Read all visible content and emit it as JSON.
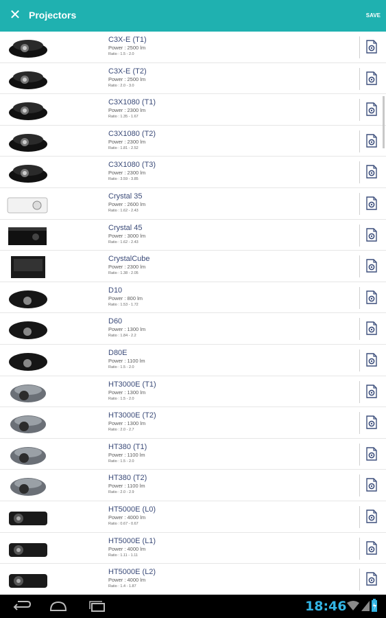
{
  "app": {
    "title": "Projectors",
    "save_label": "SAVE",
    "close_icon": "close-icon"
  },
  "projectors": [
    {
      "name": "C3X-E (T1)",
      "power": "Power : 2500 lm",
      "ratio": "Ratio : 1.5 - 2.0",
      "style": "dark"
    },
    {
      "name": "C3X-E (T2)",
      "power": "Power : 2500 lm",
      "ratio": "Ratio : 2.0 - 3.0",
      "style": "dark"
    },
    {
      "name": "C3X1080 (T1)",
      "power": "Power : 2300 lm",
      "ratio": "Ratio : 1.35 - 1.67",
      "style": "dark"
    },
    {
      "name": "C3X1080 (T2)",
      "power": "Power : 2300 lm",
      "ratio": "Ratio : 1.81 - 2.52",
      "style": "dark"
    },
    {
      "name": "C3X1080 (T3)",
      "power": "Power : 2300 lm",
      "ratio": "Ratio : 3.59 - 3.85",
      "style": "dark"
    },
    {
      "name": "Crystal 35",
      "power": "Power : 2600 lm",
      "ratio": "Ratio : 1.62 - 2.43",
      "style": "white"
    },
    {
      "name": "Crystal 45",
      "power": "Power : 3000 lm",
      "ratio": "Ratio : 1.62 - 2.43",
      "style": "box"
    },
    {
      "name": "CrystalCube",
      "power": "Power : 2300 lm",
      "ratio": "Ratio : 1.38 - 2.05",
      "style": "cube"
    },
    {
      "name": "D10",
      "power": "Power : 800 lm",
      "ratio": "Ratio : 1.53 - 1.72",
      "style": "round"
    },
    {
      "name": "D60",
      "power": "Power : 1300 lm",
      "ratio": "Ratio : 1.84 - 2.2",
      "style": "round"
    },
    {
      "name": "D80E",
      "power": "Power : 1100 lm",
      "ratio": "Ratio : 1.5 - 2.0",
      "style": "round"
    },
    {
      "name": "HT3000E (T1)",
      "power": "Power : 1300 lm",
      "ratio": "Ratio : 1.5 - 2.0",
      "style": "gray"
    },
    {
      "name": "HT3000E (T2)",
      "power": "Power : 1300 lm",
      "ratio": "Ratio : 2.0 - 2.7",
      "style": "gray"
    },
    {
      "name": "HT380 (T1)",
      "power": "Power : 1100 lm",
      "ratio": "Ratio : 1.5 - 2.0",
      "style": "gray"
    },
    {
      "name": "HT380 (T2)",
      "power": "Power : 1100 lm",
      "ratio": "Ratio : 2.0 - 2.9",
      "style": "gray"
    },
    {
      "name": "HT5000E (L0)",
      "power": "Power : 4000 lm",
      "ratio": "Ratio : 0.67 - 0.67",
      "style": "wide"
    },
    {
      "name": "HT5000E (L1)",
      "power": "Power : 4000 lm",
      "ratio": "Ratio : 1.11 - 1.11",
      "style": "wide"
    },
    {
      "name": "HT5000E (L2)",
      "power": "Power : 4000 lm",
      "ratio": "Ratio : 1.4 - 1.87",
      "style": "wide"
    }
  ],
  "statusbar": {
    "time": "18:46"
  },
  "colors": {
    "appbar": "#1fb1b0",
    "accent": "#33b5e5",
    "name_text": "#3a4a78"
  }
}
